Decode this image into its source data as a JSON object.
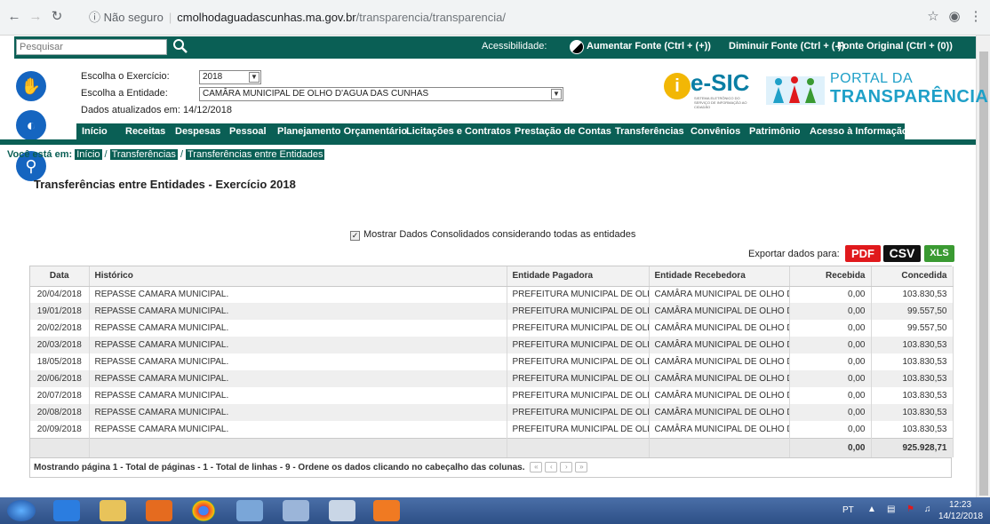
{
  "browser": {
    "secure_label": "Não seguro",
    "url_host": "cmolhodaguadascunhas.ma.gov.br",
    "url_path": "/transparencia/transparencia/"
  },
  "topbar": {
    "search_placeholder": "Pesquisar",
    "accessibility": "Acessibilidade:",
    "increase_font": "Aumentar Fonte (Ctrl + (+))",
    "decrease_font": "Diminuir Fonte (Ctrl + (-))",
    "original_font": "Fonte Original (Ctrl + (0))"
  },
  "filters": {
    "exercise_label": "Escolha o Exercício:",
    "exercise_value": "2018",
    "entity_label": "Escolha a Entidade:",
    "entity_value": "CAMÂRA MUNICIPAL DE OLHO D'AGUA DAS CUNHAS",
    "updated": "Dados atualizados em: 14/12/2018"
  },
  "logos": {
    "esic": "e-SIC",
    "esic_sub": "SISTEMA ELETRÔNICO DO SERVIÇO DE INFORMAÇÃO AO CIDADÃO",
    "portal_l1": "PORTAL DA",
    "portal_l2": "TRANSPARÊNCIA"
  },
  "menu": [
    "Início",
    "Receitas",
    "Despesas",
    "Pessoal",
    "Planejamento Orçamentário",
    "Licitações e Contratos",
    "Prestação de Contas",
    "Transferências",
    "Convênios",
    "Patrimônio",
    "Acesso à Informação"
  ],
  "breadcrumb": {
    "label": "Você está em:",
    "items": [
      "Início",
      "Transferências",
      "Transferências entre Entidades"
    ]
  },
  "page_title": "Transferências entre Entidades - Exercício 2018",
  "consolidated_label": "Mostrar Dados Consolidados considerando todas as entidades",
  "export": {
    "label": "Exportar dados para:",
    "pdf": "PDF",
    "csv": "CSV",
    "xls": "XLS"
  },
  "table": {
    "headers": [
      "Data",
      "Histórico",
      "Entidade Pagadora",
      "Entidade Recebedora",
      "Recebida",
      "Concedida"
    ],
    "rows": [
      [
        "20/04/2018",
        "REPASSE CAMARA MUNICIPAL.",
        "PREFEITURA MUNICIPAL DE OLHO",
        "CAMÂRA MUNICIPAL DE OLHO D'A",
        "0,00",
        "103.830,53"
      ],
      [
        "19/01/2018",
        "REPASSE CAMARA MUNICIPAL.",
        "PREFEITURA MUNICIPAL DE OLHO",
        "CAMÂRA MUNICIPAL DE OLHO D'A",
        "0,00",
        "99.557,50"
      ],
      [
        "20/02/2018",
        "REPASSE CAMARA MUNICIPAL.",
        "PREFEITURA MUNICIPAL DE OLHO",
        "CAMÂRA MUNICIPAL DE OLHO D'A",
        "0,00",
        "99.557,50"
      ],
      [
        "20/03/2018",
        "REPASSE CAMARA MUNICIPAL.",
        "PREFEITURA MUNICIPAL DE OLHO",
        "CAMÂRA MUNICIPAL DE OLHO D'A",
        "0,00",
        "103.830,53"
      ],
      [
        "18/05/2018",
        "REPASSE CAMARA MUNICIPAL.",
        "PREFEITURA MUNICIPAL DE OLHO",
        "CAMÂRA MUNICIPAL DE OLHO D'A",
        "0,00",
        "103.830,53"
      ],
      [
        "20/06/2018",
        "REPASSE CAMARA MUNICIPAL.",
        "PREFEITURA MUNICIPAL DE OLHO",
        "CAMÂRA MUNICIPAL DE OLHO D'A",
        "0,00",
        "103.830,53"
      ],
      [
        "20/07/2018",
        "REPASSE CAMARA MUNICIPAL.",
        "PREFEITURA MUNICIPAL DE OLHO",
        "CAMÂRA MUNICIPAL DE OLHO D'A",
        "0,00",
        "103.830,53"
      ],
      [
        "20/08/2018",
        "REPASSE CAMARA MUNICIPAL.",
        "PREFEITURA MUNICIPAL DE OLHO",
        "CAMÂRA MUNICIPAL DE OLHO D'A",
        "0,00",
        "103.830,53"
      ],
      [
        "20/09/2018",
        "REPASSE CAMARA MUNICIPAL.",
        "PREFEITURA MUNICIPAL DE OLHO",
        "CAMÂRA MUNICIPAL DE OLHO D'A",
        "0,00",
        "103.830,53"
      ]
    ],
    "total_recebida": "0,00",
    "total_concedida": "925.928,71",
    "pager_text": "Mostrando página 1 - Total de páginas - 1 - Total de linhas - 9 - Ordene os dados clicando no cabeçalho das colunas."
  },
  "tray": {
    "lang": "PT",
    "time": "12:23",
    "date": "14/12/2018"
  },
  "colors": {
    "brand_green": "#0a5f55",
    "pdf_red": "#e0191c",
    "csv_black": "#111111",
    "xls_green": "#3a9a32"
  }
}
